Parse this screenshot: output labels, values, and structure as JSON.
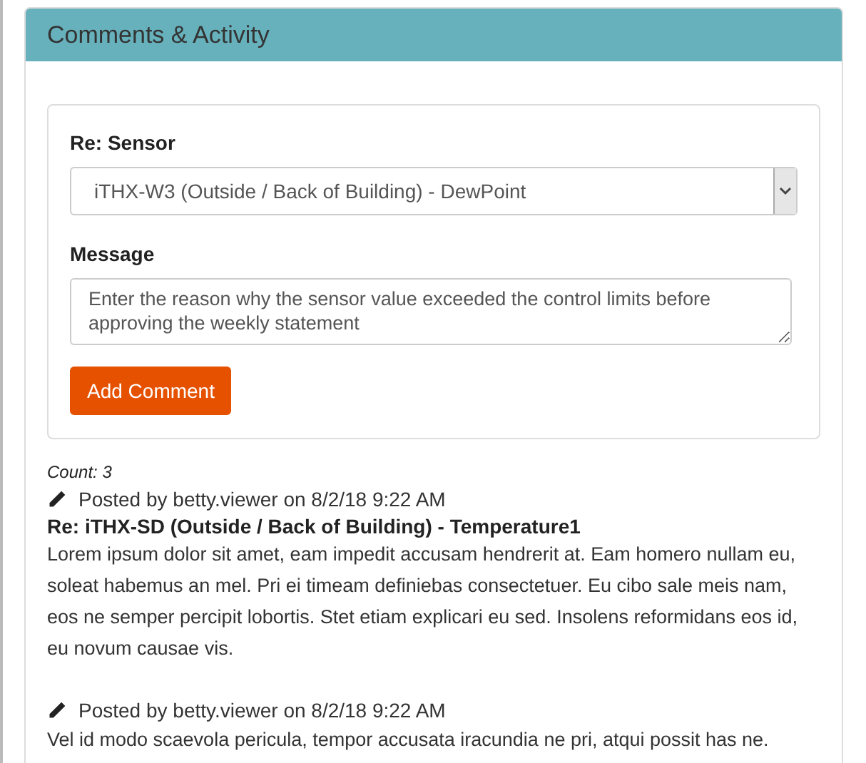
{
  "panel": {
    "title": "Comments & Activity"
  },
  "form": {
    "sensor_label": "Re: Sensor",
    "sensor_value": "iTHX-W3 (Outside / Back of Building) - DewPoint",
    "message_label": "Message",
    "message_value": "Enter the reason why the sensor value exceeded the control limits before approving the weekly statement",
    "button": "Add Comment"
  },
  "count": "Count: 3",
  "comments": [
    {
      "posted": "Posted by betty.viewer on 8/2/18 9:22 AM",
      "subject": "Re: iTHX-SD (Outside / Back of Building) - Temperature1",
      "body": "Lorem ipsum dolor sit amet, eam impedit accusam hendrerit at. Eam homero nullam eu, soleat habemus an mel. Pri ei timeam definiebas consectetuer. Eu cibo sale meis nam, eos ne semper percipit lobortis. Stet etiam explicari eu sed. Insolens reformidans eos id, eu novum causae vis."
    },
    {
      "posted": "Posted by betty.viewer on 8/2/18 9:22 AM",
      "body": "Vel id modo scaevola pericula, tempor accusata iracundia ne pri, atqui possit has ne."
    }
  ]
}
